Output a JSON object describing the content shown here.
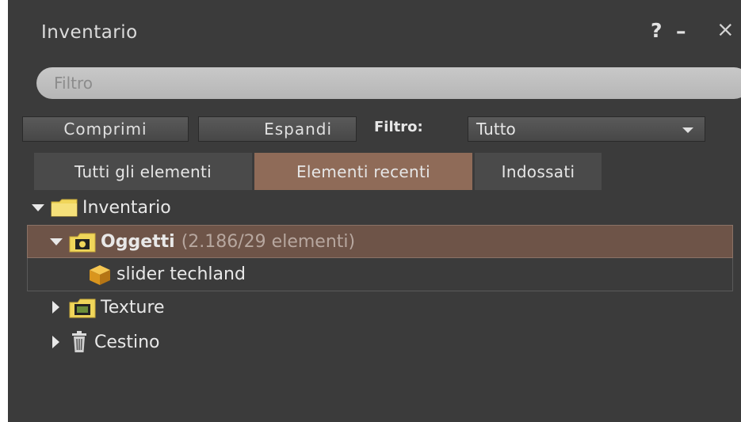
{
  "window": {
    "title": "Inventario",
    "help_label": "?",
    "minimize_label": "–",
    "close_label": "×"
  },
  "search": {
    "placeholder": "Filtro",
    "value": ""
  },
  "toolbar": {
    "collapse_label": "Comprimi",
    "expand_label": "Espandi",
    "filter_label": "Filtro:",
    "filter_value": "Tutto"
  },
  "tabs": [
    {
      "label": "Tutti gli elementi",
      "active": false
    },
    {
      "label": "Elementi recenti",
      "active": true
    },
    {
      "label": "Indossati",
      "active": false
    }
  ],
  "tree": {
    "root": {
      "label": "Inventario",
      "icon": "folder-icon",
      "expanded": true
    },
    "objects": {
      "label": "Oggetti",
      "count": "(2.186/29 elementi)",
      "icon": "objects-folder-icon",
      "expanded": true
    },
    "item": {
      "label": "slider techland",
      "icon": "object-box-icon"
    },
    "texture": {
      "label": "Texture",
      "icon": "texture-folder-icon",
      "expanded": false
    },
    "trash": {
      "label": "Cestino",
      "icon": "trash-icon",
      "expanded": false
    }
  },
  "colors": {
    "panel_bg": "#3b3b3b",
    "active_tab": "#8f6b58",
    "selected_row": "#6e5448",
    "folder_yellow": "#f0d65a"
  }
}
